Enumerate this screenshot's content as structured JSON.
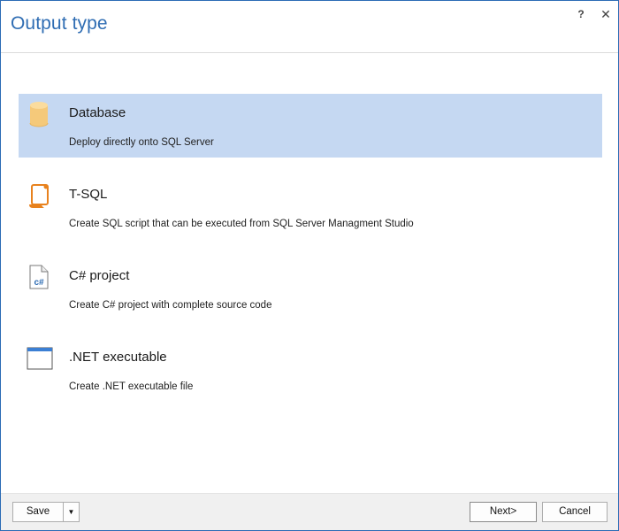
{
  "window": {
    "title": "Output type",
    "help_label": "?",
    "close_label": "✕"
  },
  "options": [
    {
      "title": "Database",
      "description": "Deploy directly onto SQL Server",
      "icon": "database-icon",
      "selected": true
    },
    {
      "title": "T-SQL",
      "description": "Create SQL script that can be executed from SQL Server Managment Studio",
      "icon": "script-icon",
      "selected": false
    },
    {
      "title": "C# project",
      "description": "Create C# project with complete source code",
      "icon": "csharp-file-icon",
      "selected": false
    },
    {
      "title": ".NET executable",
      "description": "Create .NET executable file",
      "icon": "window-icon",
      "selected": false
    }
  ],
  "footer": {
    "save_label": "Save",
    "save_dropdown_glyph": "▼",
    "next_label": "Next>",
    "cancel_label": "Cancel"
  },
  "colors": {
    "selection": "#c5d8f2",
    "title": "#2f6db3",
    "icon_orange": "#e8821e",
    "database_icon": "#f5c97a"
  }
}
